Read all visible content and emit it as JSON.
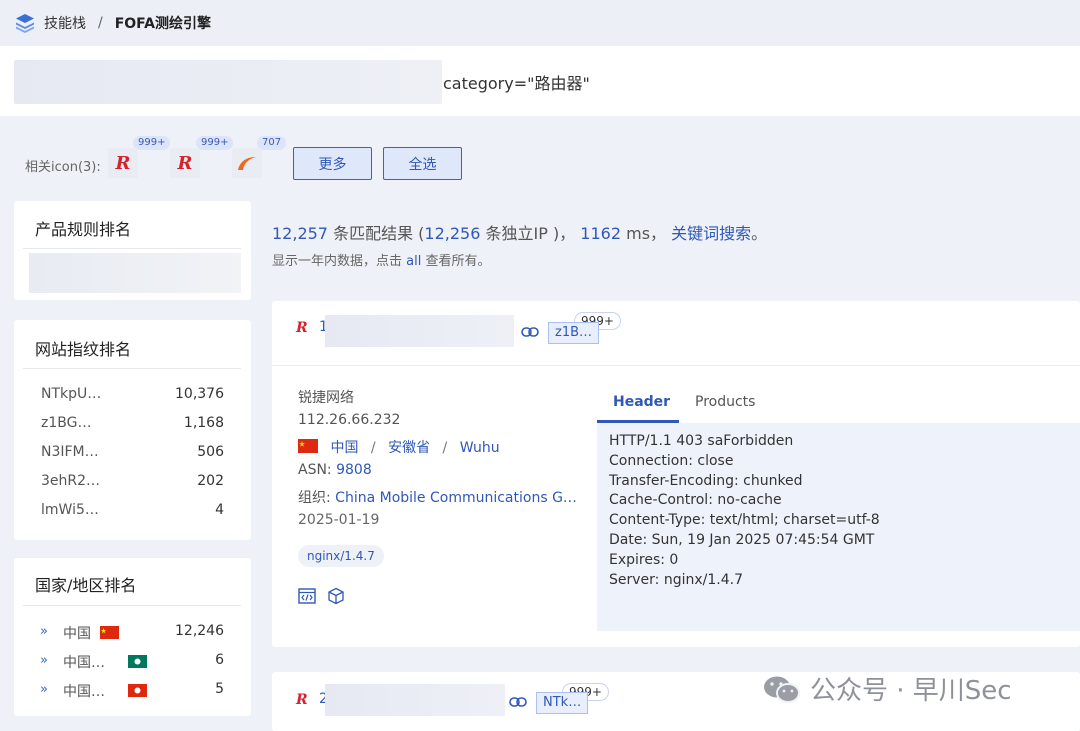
{
  "breadcrumb": {
    "home": "技能栈",
    "separator": "/",
    "current": "FOFA测绘引擎"
  },
  "search": {
    "query": "category=\"路由器\""
  },
  "related_icons": {
    "label": "相关icon(3):",
    "icons": [
      {
        "name": "ruijie-r-icon",
        "count": "999+"
      },
      {
        "name": "ruijie-r-icon-2",
        "count": "999+"
      },
      {
        "name": "swoosh-logo-icon",
        "count": "707"
      }
    ],
    "more_label": "更多",
    "select_all_label": "全选"
  },
  "product_panel": {
    "title": "产品规则排名"
  },
  "fingerprint_panel": {
    "title": "网站指纹排名",
    "rows": [
      {
        "name": "NTkpU…",
        "value": "10,376"
      },
      {
        "name": "z1BG…",
        "value": "1,168"
      },
      {
        "name": "N3IFM…",
        "value": "506"
      },
      {
        "name": "3ehR2…",
        "value": "202"
      },
      {
        "name": "lmWi5…",
        "value": "4"
      }
    ]
  },
  "country_panel": {
    "title": "国家/地区排名",
    "rows": [
      {
        "name": "中国",
        "value": "12,246"
      },
      {
        "name": "中国…",
        "value": "6"
      },
      {
        "name": "中国…",
        "value": "5"
      }
    ]
  },
  "stats": {
    "matches": "12,257",
    "matches_label": "条匹配结果 (",
    "ips": "12,256",
    "ips_label": "条独立IP )，",
    "ms": "1162",
    "ms_label": "ms，",
    "keyword_link": "关键词搜索",
    "end": "。",
    "sub_prefix": "显示一年内数据，点击",
    "sub_link": "all",
    "sub_suffix": "查看所有。"
  },
  "result1": {
    "host_prefix": "1",
    "tag": "z1B…",
    "tag_badge": "999+",
    "org_name": "锐捷网络",
    "ip": "112.26.66.232",
    "country": "中国",
    "sep": "/",
    "province": "安徽省",
    "city": "Wuhu",
    "asn_label": "ASN:",
    "asn": "9808",
    "org_label": "组织:",
    "org": "China Mobile Communications G…",
    "date": "2025-01-19",
    "server_tag": "nginx/1.4.7",
    "tabs": {
      "header": "Header",
      "products": "Products"
    },
    "header_lines": [
      "HTTP/1.1 403 saForbidden",
      "Connection: close",
      "Transfer-Encoding: chunked",
      "Cache-Control: no-cache",
      "Content-Type: text/html; charset=utf-8",
      "Date: Sun, 19 Jan 2025 07:45:54 GMT",
      "Expires: 0",
      "Server: nginx/1.4.7"
    ]
  },
  "result2": {
    "host_prefix": "2",
    "tag": "NTk…",
    "tag_badge": "999+"
  },
  "watermark": {
    "text": "公众号 · 早川Sec"
  },
  "colors": {
    "accent": "#2f58b8",
    "brand_red": "#d3242c",
    "background": "#eef1f7"
  }
}
